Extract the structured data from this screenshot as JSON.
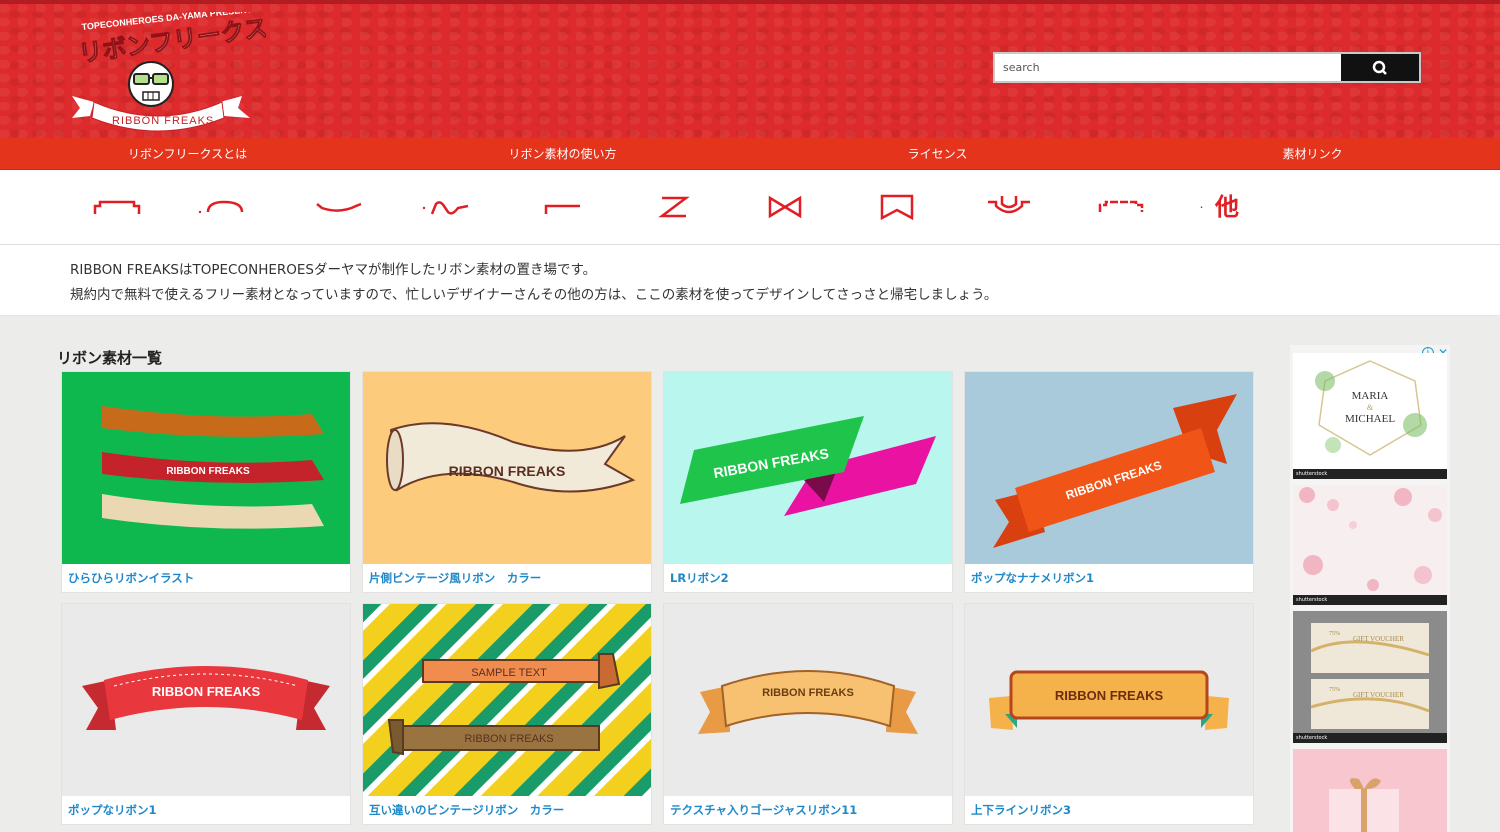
{
  "header": {
    "logo_presents": "TOPECONHEROES DA-YAMA PRESENTS",
    "logo_title": "リボンフリークス",
    "logo_banner": "RIBBON FREAKS",
    "search_placeholder": "search"
  },
  "nav": {
    "items": [
      {
        "label": "リボンフリークスとは"
      },
      {
        "label": "リボン素材の使い方"
      },
      {
        "label": "ライセンス"
      },
      {
        "label": "素材リンク"
      }
    ]
  },
  "shape_nav": {
    "items": [
      "shape-flat",
      "shape-arch",
      "shape-wave",
      "shape-s",
      "shape-step",
      "shape-z",
      "shape-bow",
      "shape-banner",
      "shape-shield",
      "shape-steps"
    ],
    "other_label": "他"
  },
  "intro": {
    "line1": "RIBBON FREAKSはTOPECONHEROESダーヤマが制作したリボン素材の置き場です。",
    "line2": "規約内で無料で使えるフリー素材となっていますので、忙しいデザイナーさんその他の方は、ここの素材を使ってデザインしてさっさと帰宅しましょう。"
  },
  "main": {
    "heading": "リボン素材一覧",
    "cards": [
      {
        "title": "ひらひらリボンイラスト",
        "thumb_text": "RIBBON FREAKS",
        "bg": "#0fb84e"
      },
      {
        "title": "片側ビンテージ風リボン　カラー",
        "thumb_text": "RIBBON FREAKS",
        "bg": "#fdcb7c"
      },
      {
        "title": "LRリボン2",
        "thumb_text": "RIBBON FREAKS",
        "bg": "#b8f6ee"
      },
      {
        "title": "ポップなナナメリボン1",
        "thumb_text": "RIBBON FREAKS",
        "bg": "#a9cadb"
      },
      {
        "title": "ポップなリボン1",
        "thumb_text": "RIBBON FREAKS",
        "bg": "#ebeaea"
      },
      {
        "title": "互い違いのビンテージリボン　カラー",
        "thumb_text": "RIBBON FREAKS",
        "thumb_text2": "SAMPLE TEXT",
        "bg": "#f3d01e"
      },
      {
        "title": "テクスチャ入りゴージャスリボン11",
        "thumb_text": "RIBBON FREAKS",
        "bg": "#ebeaea"
      },
      {
        "title": "上下ラインリボン3",
        "thumb_text": "RIBBON FREAKS",
        "bg": "#ebeaea"
      }
    ]
  },
  "ad": {
    "card1_line1": "MARIA",
    "card1_amp": "&",
    "card1_line2": "MICHAEL",
    "stock_label": "shutterstock",
    "voucher_text": "GIFT VOUCHER",
    "voucher_pct": "75%"
  },
  "colors": {
    "header_red": "#dd2a2c",
    "nav_red": "#e4341c",
    "link_blue": "#1e88c9",
    "icon_red": "#e01f24"
  }
}
